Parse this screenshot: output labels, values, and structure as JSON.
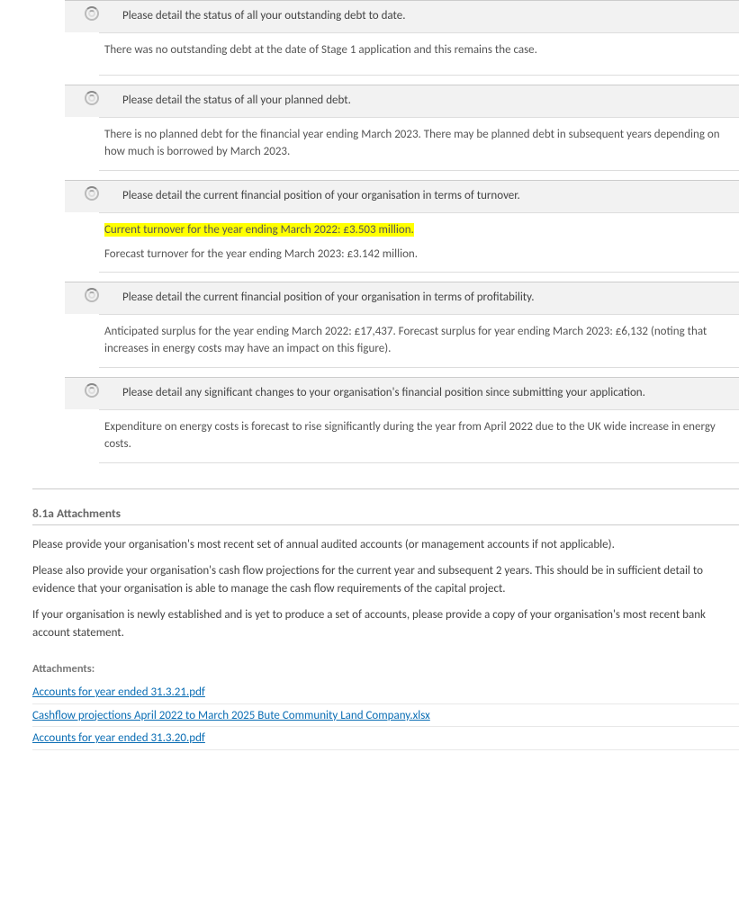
{
  "qa": [
    {
      "q": "Please detail the status of all your outstanding debt to date.",
      "a": "There was no outstanding debt at the date of Stage 1 application and this remains the case."
    },
    {
      "q": "Please detail the status of all your planned debt.",
      "a": "There is no planned debt for the financial year ending March 2023. There may be planned debt in subsequent years depending on how much is borrowed by March 2023."
    },
    {
      "q": "Please detail the current financial position of your organisation in terms of turnover.",
      "a_raw": "Current turnover for the year ending March 2022: £3.503 million.",
      "a_plain": "",
      "highlighted": true,
      "a_extra": "Forecast turnover for the year ending March 2023: £3.142 million."
    },
    {
      "q": "Please detail the current financial position of your organisation in terms of profitability.",
      "a": "Anticipated surplus for the year ending March 2022: £17,437. Forecast surplus for year ending March 2023: £6,132 (noting that increases in energy costs may have an impact on this figure)."
    },
    {
      "q": "Please detail any significant changes to your organisation's financial position since submitting your application.",
      "a": "Expenditure on energy costs is forecast to rise significantly during the year from April 2022 due to the UK wide increase in energy costs."
    }
  ],
  "attach": {
    "title": "8.1a Attachments",
    "para1": "Please provide your organisation's most recent set of annual audited accounts (or management accounts if not applicable).",
    "para2": "Please also provide your organisation's cash flow projections for the current year and subsequent 2 years. This should be in sufficient detail to evidence that your organisation is able to manage the cash flow requirements of the capital project.",
    "para3": "If your organisation is newly established and is yet to produce a set of accounts, please provide a copy of your organisation's most recent bank account statement.",
    "list_label": "Attachments:",
    "files": [
      "Accounts for year ended 31.3.21.pdf",
      "Cashflow projections April 2022 to March 2025 Bute Community Land Company.xlsx",
      "Accounts for year ended 31.3.20.pdf"
    ]
  }
}
